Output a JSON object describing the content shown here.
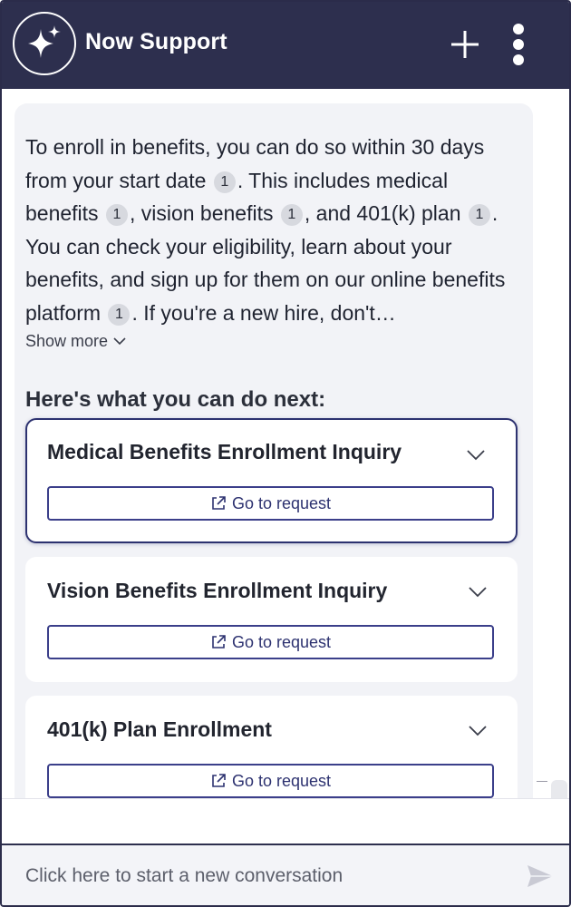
{
  "header": {
    "title": "Now Support",
    "logo_icon": "sparkle-icon",
    "new_chat_icon": "plus-icon",
    "menu_icon": "kebab-menu-icon"
  },
  "message": {
    "segments": [
      "To enroll in benefits, you can do so within 30 days from your start date",
      ". This includes medical benefits",
      ", vision benefits",
      ", and 401(k) plan",
      ". You can check your eligibility, learn about your benefits, and sign up for them on our online benefits platform",
      ". If you're a new hire, don't…"
    ],
    "citation": "1",
    "show_more": "Show more"
  },
  "next_steps": {
    "heading": "Here's what you can do next:",
    "cards": [
      {
        "title": "Medical Benefits Enrollment Inquiry",
        "button": "Go to request"
      },
      {
        "title": "Vision Benefits Enrollment Inquiry",
        "button": "Go to request"
      },
      {
        "title": "401(k) Plan Enrollment",
        "button": "Go to request"
      }
    ]
  },
  "footer": {
    "placeholder": "Click here to start a new conversation",
    "send_icon": "send-icon"
  },
  "colors": {
    "header_bg": "#2d2f4e",
    "accent": "#2d3270",
    "bubble_bg": "#f2f3f7"
  }
}
